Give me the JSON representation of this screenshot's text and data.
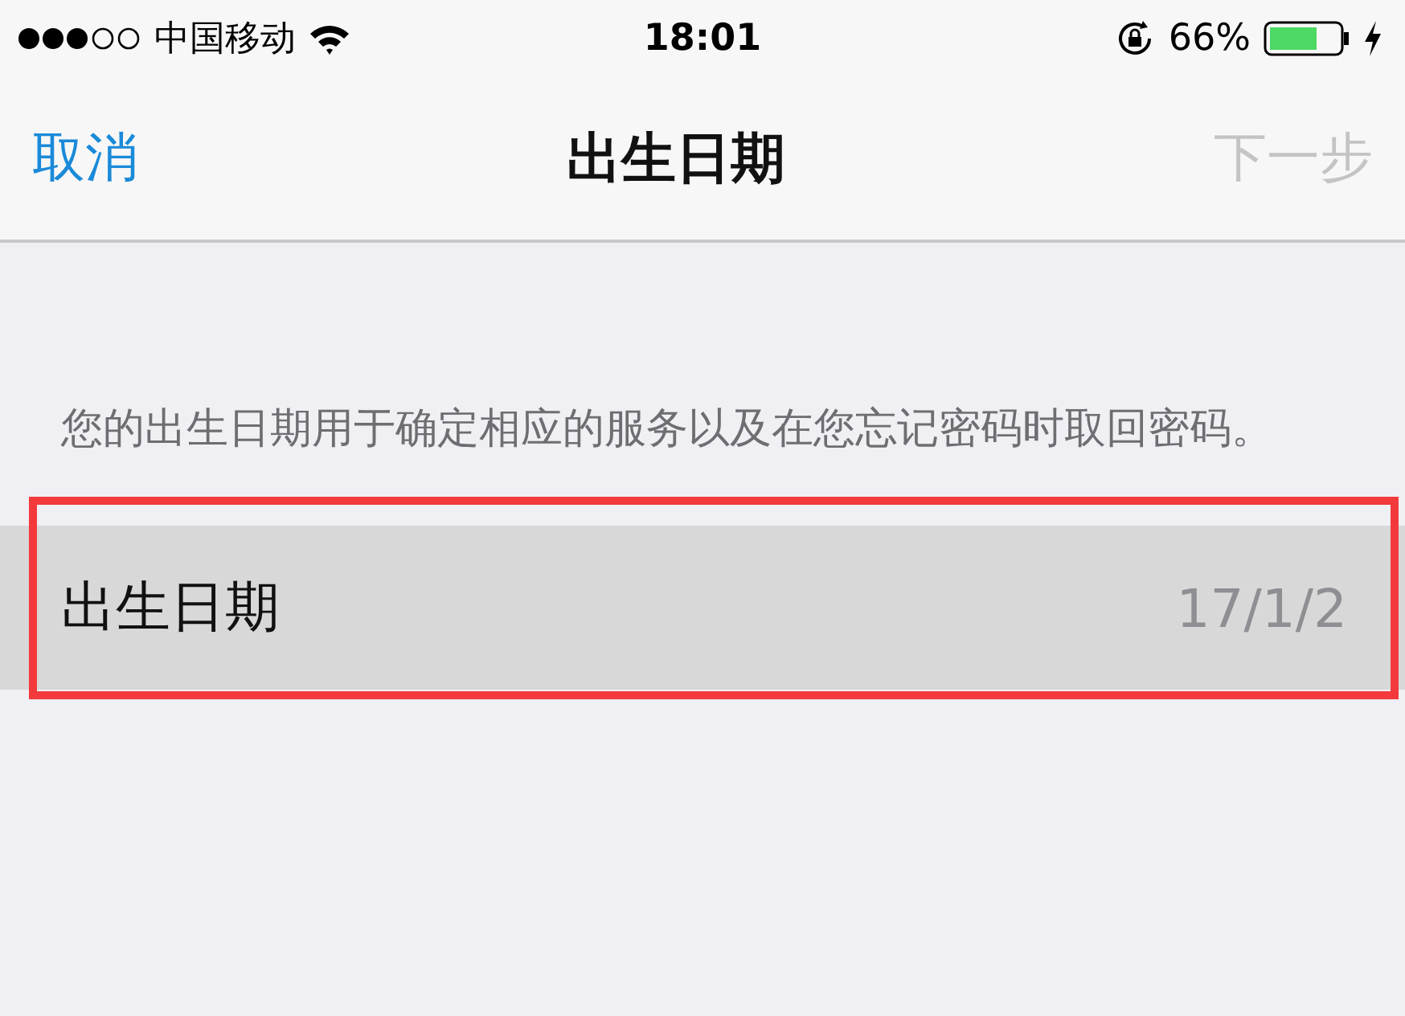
{
  "status_bar": {
    "carrier": "中国移动",
    "time": "18:01",
    "battery": "66%"
  },
  "nav": {
    "cancel": "取消",
    "title": "出生日期",
    "next": {
      "label": "下一步",
      "disabled": true
    }
  },
  "description": "您的出生日期用于确定相应的服务以及在您忘记密码时取回密码。",
  "row": {
    "label": "出生日期",
    "value": "17/1/2",
    "selected": true
  },
  "annotation": {
    "kind": "highlight-frame",
    "color": "#f23a3c"
  }
}
